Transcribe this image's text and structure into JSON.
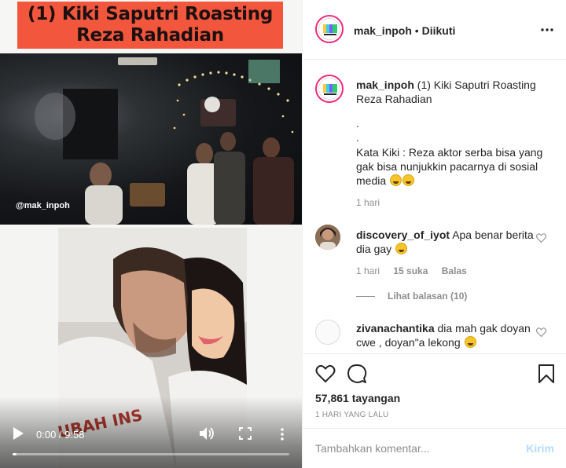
{
  "video": {
    "title_line1": "(1) Kiki Saputri Roasting",
    "title_line2": "Reza Rahadian",
    "watermark": "@mak_inpoh",
    "time": "0:00 / 9:58",
    "progress_fraction": 0,
    "icons": [
      "play-icon",
      "volume-icon",
      "fullscreen-icon",
      "more-vertical-icon"
    ]
  },
  "header": {
    "username": "mak_inpoh",
    "separator": " • ",
    "follow_status": "Diikuti",
    "more_icon": "more-horizontal-icon"
  },
  "caption": {
    "username": "mak_inpoh",
    "text": "(1) Kiki Saputri Roasting Reza Rahadian",
    "dot1": ".",
    "dot2": ".",
    "kata": "Kata Kiki : Reza aktor serba bisa yang gak bisa nunjukkin pacarnya di sosial media",
    "emoji": "rofl-emoji",
    "time": "1 hari"
  },
  "comments": [
    {
      "username": "discovery_of_iyot",
      "text": "Apa benar berita dia gay",
      "emoji": "grin-sweat-emoji",
      "time": "1 hari",
      "likes": "15 suka",
      "reply": "Balas"
    },
    {
      "username": "zivanachantika",
      "text": "dia mah gak doyan cwe , doyan\"a lekong",
      "emoji": "grimace-emoji"
    }
  ],
  "view_replies": "Lihat balasan (10)",
  "actions": {
    "icons": [
      "heart-icon",
      "comment-icon",
      "bookmark-icon"
    ],
    "views": "57,861 tayangan",
    "date": "1 HARI YANG LALU"
  },
  "add_comment": {
    "placeholder": "Tambahkan komentar...",
    "send": "Kirim"
  },
  "colors": {
    "title_bg": "#f2563c",
    "send_disabled": "#b3dbff",
    "muted": "#8e8e8e",
    "story_ring": "#ee2a7b"
  }
}
